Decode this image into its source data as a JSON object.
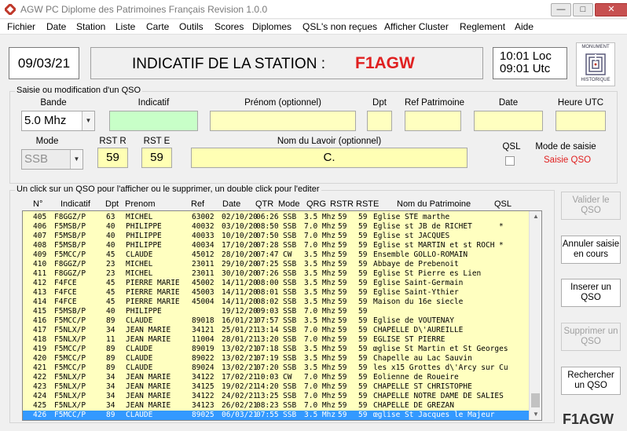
{
  "window": {
    "title": "AGW PC   Diplome des Patrimoines Français Revision  1.0.0"
  },
  "menu": [
    "Fichier",
    "Date",
    "Station",
    "Liste",
    "Carte",
    "Outils",
    "Scores",
    "Diplomes",
    "QSL's non reçues",
    "Afficher Cluster",
    "Reglement",
    "Aide"
  ],
  "header": {
    "date": "09/03/21",
    "station_label": "INDICATIF DE LA STATION  :",
    "station_call": "F1AGW",
    "time_loc": "10:01 Loc",
    "time_utc": "09:01 Utc",
    "logo_top": "MONUMENT",
    "logo_bottom": "HISTORIQUE"
  },
  "form": {
    "group_title": "Saisie ou modification d'un QSO",
    "labels": {
      "bande": "Bande",
      "indicatif": "Indicatif",
      "prenom": "Prénom (optionnel)",
      "dpt": "Dpt",
      "ref": "Ref Patrimoine",
      "date": "Date",
      "heure": "Heure UTC",
      "mode": "Mode",
      "rstr": "RST R",
      "rste": "RST E",
      "lavoir": "Nom du Lavoir (optionnel)",
      "qsl": "QSL",
      "mode_saisie": "Mode de saisie"
    },
    "bande_value": "5.0 Mhz",
    "mode_value": "SSB",
    "rstr_value": "59",
    "rste_value": "59",
    "lavoir_value": "C.",
    "mode_saisie_value": "Saisie QSO"
  },
  "list": {
    "group_title": "Un click sur un QSO pour l'afficher ou le supprimer, un double click pour l'editer",
    "columns": [
      "N°",
      "Indicatif",
      "Dpt",
      "Prenom",
      "Ref",
      "Date",
      "QTR",
      "Mode",
      "QRG",
      "RSTR",
      "RSTE",
      "Nom du Patrimoine",
      "QSL"
    ],
    "rows": [
      [
        "405",
        "F8GGZ/P",
        "63",
        "MICHEL",
        "63002",
        "02/10/20",
        "06:26",
        "SSB",
        "3.5 Mhz",
        "59",
        "59",
        "Eglise STE marthe",
        ""
      ],
      [
        "406",
        "F5MSB/P",
        "40",
        "PHILIPPE",
        "40032",
        "03/10/20",
        "08:50",
        "SSB",
        "7.0 Mhz",
        "59",
        "59",
        "Eglise st JB de RICHET",
        "*"
      ],
      [
        "407",
        "F5MSB/P",
        "40",
        "PHILIPPE",
        "40033",
        "10/10/20",
        "07:50",
        "SSB",
        "7.0 Mhz",
        "59",
        "59",
        "Eglise st JACQUES",
        ""
      ],
      [
        "408",
        "F5MSB/P",
        "40",
        "PHILIPPE",
        "40034",
        "17/10/20",
        "07:28",
        "SSB",
        "7.0 Mhz",
        "59",
        "59",
        "Eglise st MARTIN et st ROCH",
        "*"
      ],
      [
        "409",
        "F5MCC/P",
        "45",
        "CLAUDE",
        "45012",
        "28/10/20",
        "07:47",
        "CW",
        "3.5 Mhz",
        "59",
        "59",
        "Ensemble GOLLO-ROMAIN",
        ""
      ],
      [
        "410",
        "F8GGZ/P",
        "23",
        "MICHEL",
        "23011",
        "29/10/20",
        "07:25",
        "SSB",
        "3.5 Mhz",
        "59",
        "59",
        "Abbaye de Prebenoit",
        ""
      ],
      [
        "411",
        "F8GGZ/P",
        "23",
        "MICHEL",
        "23011",
        "30/10/20",
        "07:26",
        "SSB",
        "3.5 Mhz",
        "59",
        "59",
        "Eglise St Pierre es Lien",
        ""
      ],
      [
        "412",
        "F4FCE",
        "45",
        "PIERRE MARIE",
        "45002",
        "14/11/20",
        "08:00",
        "SSB",
        "3.5 Mhz",
        "59",
        "59",
        "Eglise Saint-Germain",
        ""
      ],
      [
        "413",
        "F4FCE",
        "45",
        "PIERRE MARIE",
        "45003",
        "14/11/20",
        "08:01",
        "SSB",
        "3.5 Mhz",
        "59",
        "59",
        "Eglise Saint-Ythier",
        ""
      ],
      [
        "414",
        "F4FCE",
        "45",
        "PIERRE MARIE",
        "45004",
        "14/11/20",
        "08:02",
        "SSB",
        "3.5 Mhz",
        "59",
        "59",
        "Maison du 16e siecle",
        ""
      ],
      [
        "415",
        "F5MSB/P",
        "40",
        "PHILIPPE",
        "",
        "19/12/20",
        "09:03",
        "SSB",
        "7.0 Mhz",
        "59",
        "59",
        "",
        ""
      ],
      [
        "416",
        "F5MCC/P",
        "89",
        "CLAUDE",
        "89018",
        "16/01/21",
        "07:57",
        "SSB",
        "3.5 Mhz",
        "59",
        "59",
        "Eglise de VOUTENAY",
        ""
      ],
      [
        "417",
        "F5NLX/P",
        "34",
        "JEAN MARIE",
        "34121",
        "25/01/21",
        "13:14",
        "SSB",
        "7.0 Mhz",
        "59",
        "59",
        "CHAPELLE D\\'AUREILLE",
        ""
      ],
      [
        "418",
        "F5NLX/P",
        "11",
        "JEAN MARIE",
        "11004",
        "28/01/21",
        "13:20",
        "SSB",
        "7.0 Mhz",
        "59",
        "59",
        "EGLISE ST PIERRE",
        ""
      ],
      [
        "419",
        "F5MCC/P",
        "89",
        "CLAUDE",
        "89019",
        "13/02/21",
        "07:18",
        "SSB",
        "3.5 Mhz",
        "59",
        "59",
        "œglise St Martin et St Georges",
        ""
      ],
      [
        "420",
        "F5MCC/P",
        "89",
        "CLAUDE",
        "89022",
        "13/02/21",
        "07:19",
        "SSB",
        "3.5 Mhz",
        "59",
        "59",
        "Chapelle au Lac Sauvin",
        ""
      ],
      [
        "421",
        "F5MCC/P",
        "89",
        "CLAUDE",
        "89024",
        "13/02/21",
        "07:20",
        "SSB",
        "3.5 Mhz",
        "59",
        "59",
        "les x15 Grottes d\\'Arcy sur Cu",
        ""
      ],
      [
        "422",
        "F5NLX/P",
        "34",
        "JEAN MARIE",
        "34122",
        "17/02/21",
        "10:03",
        "CW",
        "7.0 Mhz",
        "59",
        "59",
        "Eolienne de Roueire",
        ""
      ],
      [
        "423",
        "F5NLX/P",
        "34",
        "JEAN MARIE",
        "34125",
        "19/02/21",
        "14:20",
        "SSB",
        "7.0 Mhz",
        "59",
        "59",
        "CHAPELLE ST CHRISTOPHE",
        ""
      ],
      [
        "424",
        "F5NLX/P",
        "34",
        "JEAN MARIE",
        "34122",
        "24/02/21",
        "13:25",
        "SSB",
        "7.0 Mhz",
        "59",
        "59",
        "CHAPELLE NOTRE DAME DE SALIES",
        ""
      ],
      [
        "425",
        "F5NLX/P",
        "34",
        "JEAN MARIE",
        "34123",
        "26/02/21",
        "08:23",
        "SSB",
        "7.0 Mhz",
        "59",
        "59",
        "CHAPELLE DE GREZAN",
        ""
      ],
      [
        "426",
        "F5MCC/P",
        "89",
        "CLAUDE",
        "89025",
        "06/03/21",
        "07:55",
        "SSB",
        "3.5 Mhz",
        "59",
        "59",
        "œglise St Jacques le Majeur",
        ""
      ]
    ],
    "selected_index": 21
  },
  "buttons": {
    "valider": "Valider le QSO",
    "annuler": "Annuler saisie en cours",
    "inserer": "Inserer un QSO",
    "supprimer": "Supprimer un QSO",
    "rechercher": "Rechercher un QSO"
  },
  "footer_call": "F1AGW"
}
